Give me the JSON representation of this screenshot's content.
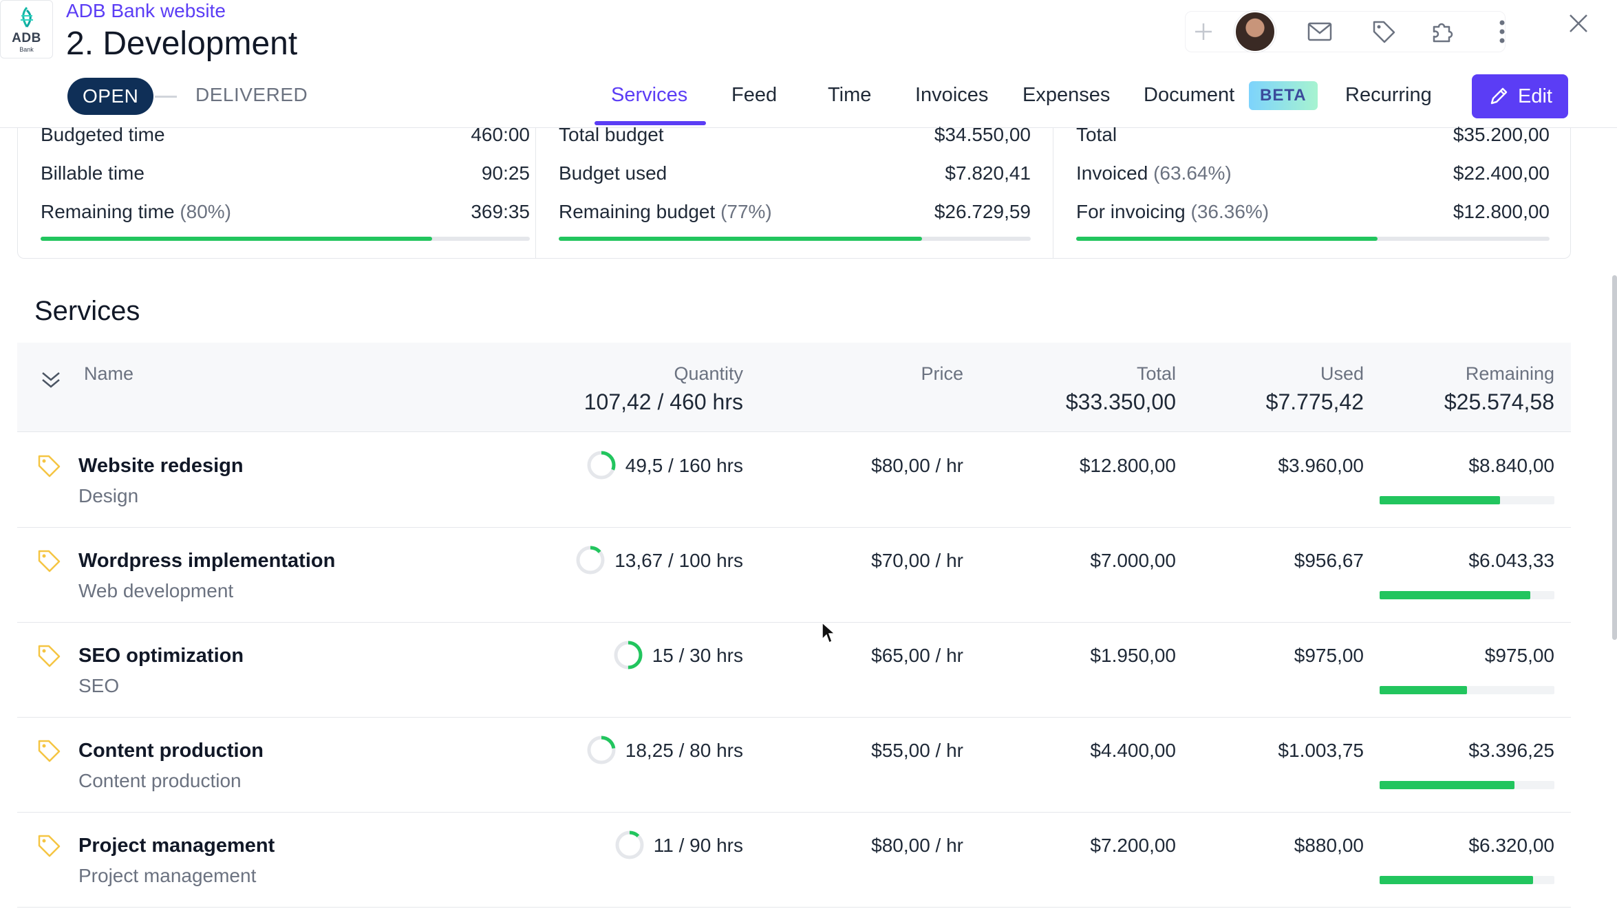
{
  "header": {
    "client": "ADB Bank website",
    "title": "2. Development",
    "logo_text": "ADB",
    "logo_sub": "Bank",
    "status_open": "OPEN",
    "status_delivered": "DELIVERED"
  },
  "tabs": [
    {
      "label": "Services",
      "active": true
    },
    {
      "label": "Feed"
    },
    {
      "label": "Time"
    },
    {
      "label": "Invoices"
    },
    {
      "label": "Expenses"
    },
    {
      "label": "Document"
    },
    {
      "label": "Recurring"
    }
  ],
  "beta_label": "BETA",
  "edit_label": "Edit",
  "summary": {
    "time": {
      "rows": [
        {
          "label": "Budgeted time",
          "pct": "",
          "value": "460:00"
        },
        {
          "label": "Billable time",
          "pct": "",
          "value": "90:25"
        },
        {
          "label": "Remaining time",
          "pct": "(80%)",
          "value": "369:35"
        }
      ],
      "progress": 0.8
    },
    "budget": {
      "rows": [
        {
          "label": "Total budget",
          "pct": "",
          "value": "$34.550,00"
        },
        {
          "label": "Budget used",
          "pct": "",
          "value": "$7.820,41"
        },
        {
          "label": "Remaining budget",
          "pct": "(77%)",
          "value": "$26.729,59"
        }
      ],
      "progress": 0.77
    },
    "invoice": {
      "rows": [
        {
          "label": "Total",
          "pct": "",
          "value": "$35.200,00"
        },
        {
          "label": "Invoiced",
          "pct": "(63.64%)",
          "value": "$22.400,00"
        },
        {
          "label": "For invoicing",
          "pct": "(36.36%)",
          "value": "$12.800,00"
        }
      ],
      "progress": 0.6364
    }
  },
  "services": {
    "heading": "Services",
    "columns": {
      "name": "Name",
      "quantity": "Quantity",
      "quantity_total": "107,42 / 460 hrs",
      "price": "Price",
      "total": "Total",
      "total_value": "$33.350,00",
      "used": "Used",
      "used_value": "$7.775,42",
      "remaining": "Remaining",
      "remaining_value": "$25.574,58"
    },
    "rows": [
      {
        "name": "Website redesign",
        "category": "Design",
        "quantity": "49,5 / 160 hrs",
        "qty_fraction": 0.31,
        "price": "$80,00 / hr",
        "total": "$12.800,00",
        "used": "$3.960,00",
        "remaining": "$8.840,00",
        "remaining_fraction": 0.69
      },
      {
        "name": "Wordpress implementation",
        "category": "Web development",
        "quantity": "13,67 / 100 hrs",
        "qty_fraction": 0.137,
        "price": "$70,00 / hr",
        "total": "$7.000,00",
        "used": "$956,67",
        "remaining": "$6.043,33",
        "remaining_fraction": 0.863
      },
      {
        "name": "SEO optimization",
        "category": "SEO",
        "quantity": "15 / 30 hrs",
        "qty_fraction": 0.5,
        "price": "$65,00 / hr",
        "total": "$1.950,00",
        "used": "$975,00",
        "remaining": "$975,00",
        "remaining_fraction": 0.5
      },
      {
        "name": "Content production",
        "category": "Content production",
        "quantity": "18,25 / 80 hrs",
        "qty_fraction": 0.228,
        "price": "$55,00 / hr",
        "total": "$4.400,00",
        "used": "$1.003,75",
        "remaining": "$3.396,25",
        "remaining_fraction": 0.772
      },
      {
        "name": "Project management",
        "category": "Project management",
        "quantity": "11 / 90 hrs",
        "qty_fraction": 0.122,
        "price": "$80,00 / hr",
        "total": "$7.200,00",
        "used": "$880,00",
        "remaining": "$6.320,00",
        "remaining_fraction": 0.878
      }
    ]
  },
  "colors": {
    "accent": "#5b3df5",
    "status_open_bg": "#0f2f57",
    "progress_green": "#22c55e",
    "tag_yellow": "#f5c542"
  }
}
